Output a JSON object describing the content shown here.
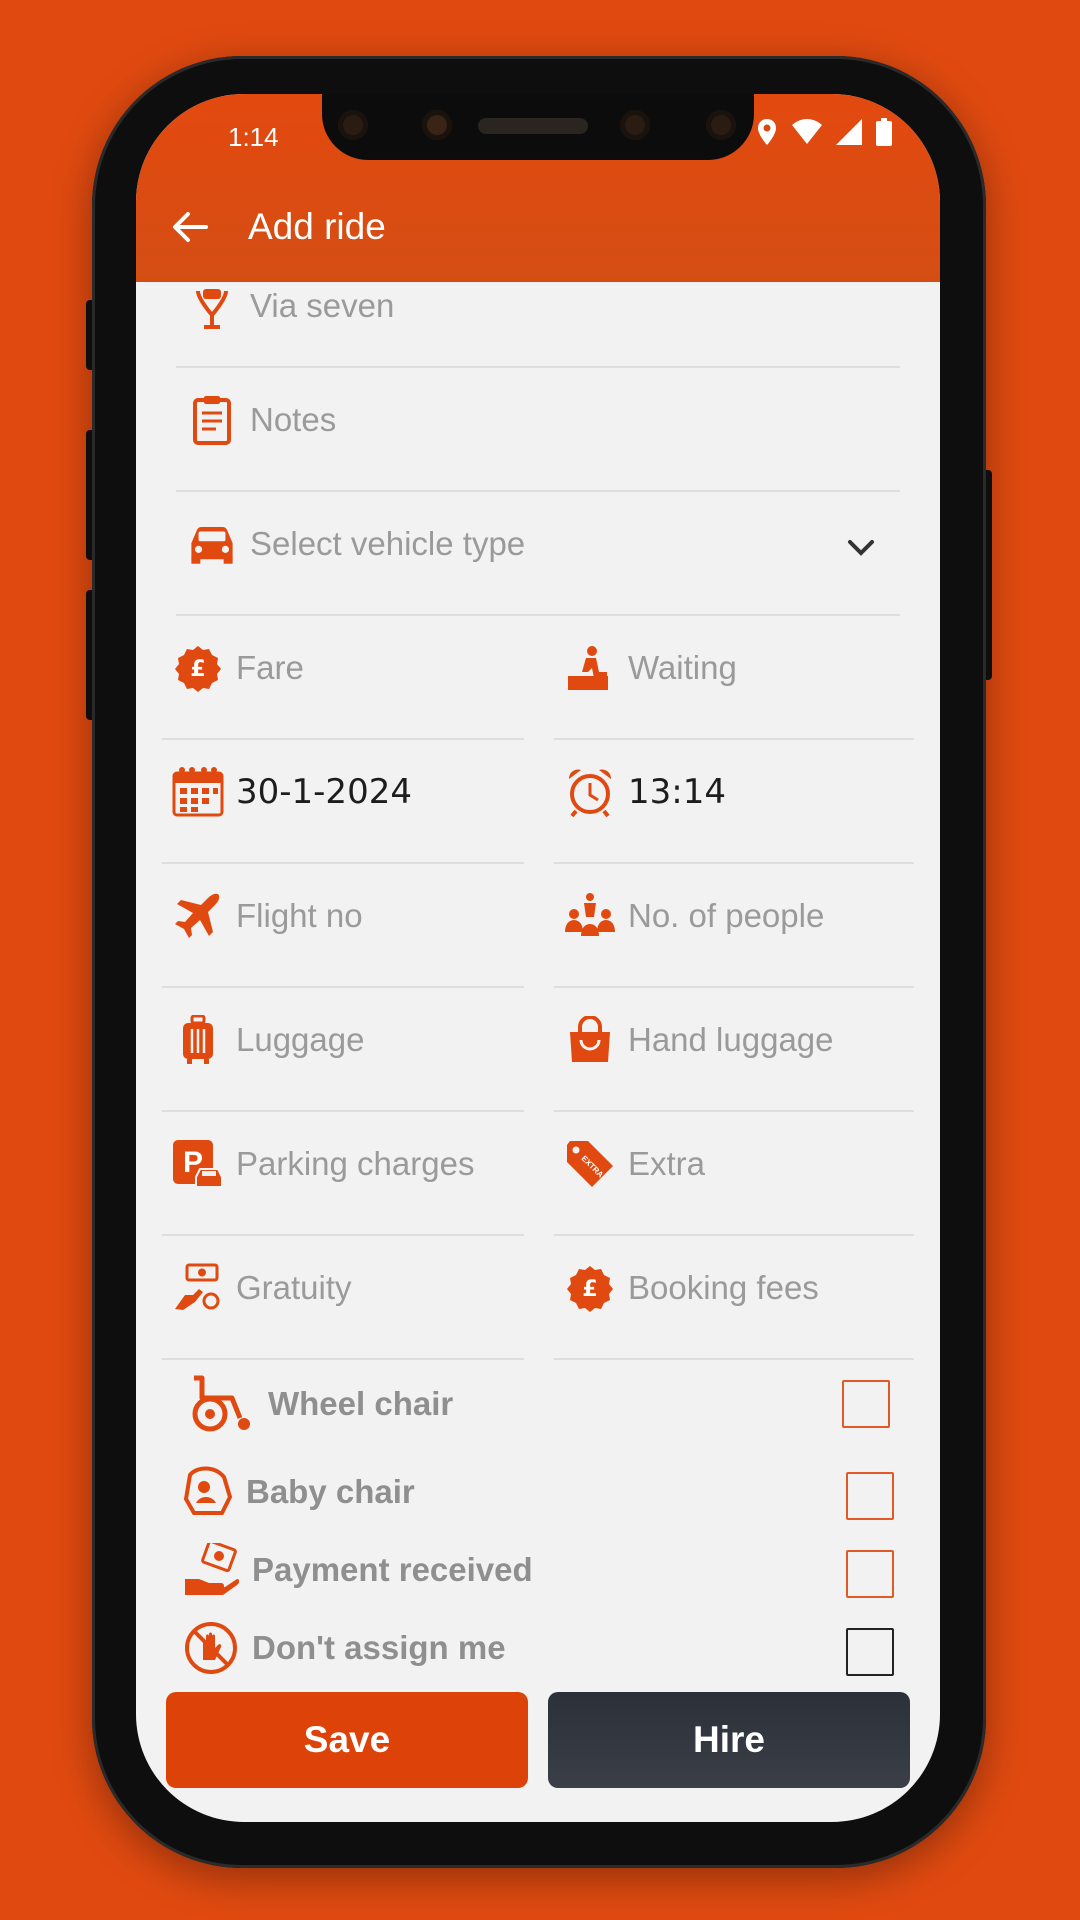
{
  "status": {
    "time": "1:14"
  },
  "appbar": {
    "title": "Add ride"
  },
  "form": {
    "via": "Via seven",
    "notes": "Notes",
    "vehicle_type": "Select vehicle type",
    "fare": "Fare",
    "waiting": "Waiting",
    "date": "30-1-2024",
    "time": "13:14",
    "flight_no": "Flight no",
    "people": "No. of people",
    "luggage": "Luggage",
    "hand_luggage": "Hand luggage",
    "parking": "Parking charges",
    "extra": "Extra",
    "gratuity": "Gratuity",
    "booking_fees": "Booking fees"
  },
  "options": {
    "wheel_chair": "Wheel chair",
    "baby_chair": "Baby chair",
    "payment_received": "Payment received",
    "dont_assign": "Don't assign me"
  },
  "actions": {
    "save": "Save",
    "hire": "Hire"
  },
  "icons": {
    "pound_badge": "£",
    "extra_tag": "EXTRA",
    "parking_letter": "P"
  },
  "colors": {
    "accent": "#e04a10",
    "dark_button": "#30343c"
  }
}
